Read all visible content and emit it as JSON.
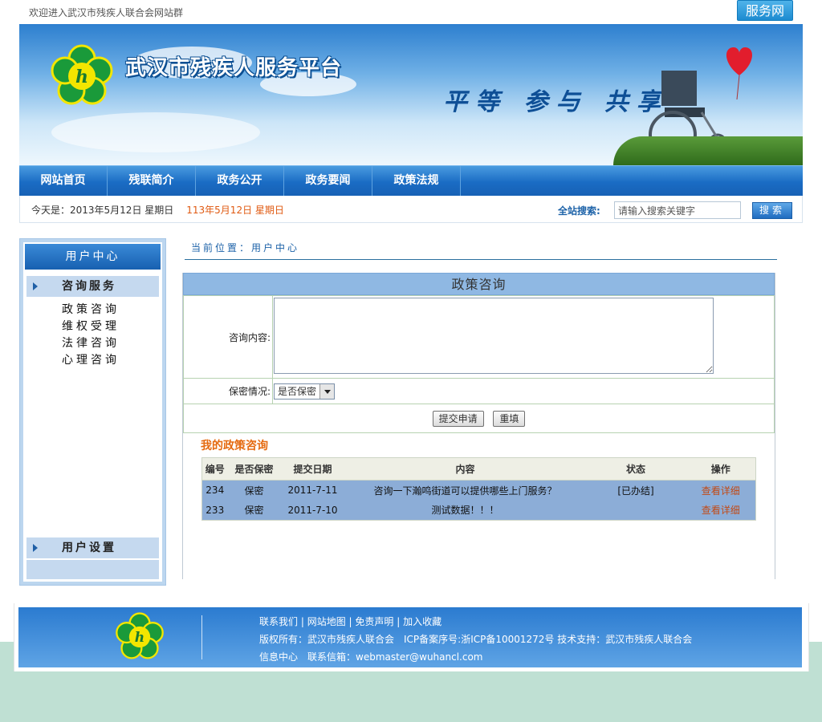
{
  "topbar": {
    "welcome": "欢迎进入武汉市残疾人联合会网站群",
    "badge": "服务网"
  },
  "banner": {
    "title": "武汉市残疾人服务平台",
    "slogan": "平等 参与 共享"
  },
  "nav": [
    "网站首页",
    "残联简介",
    "政务公开",
    "政务要闻",
    "政策法规"
  ],
  "infobar": {
    "today": "今天是：2013年5月12日 星期日",
    "today_alt": "113年5月12日 星期日",
    "search_label": "全站搜索:",
    "search_placeholder": "请输入搜索关键字",
    "search_button": "搜索"
  },
  "sidebar": {
    "header": "用户中心",
    "section1": "咨询服务",
    "items": [
      "政策咨询",
      "维权受理",
      "法律咨询",
      "心理咨询"
    ],
    "section2": "用户设置"
  },
  "breadcrumb": "当前位置：用户中心",
  "form": {
    "title": "政策咨询",
    "content_label": "咨询内容:",
    "content_value": "",
    "secret_label": "保密情况:",
    "secret_selected": "是否保密",
    "submit": "提交申请",
    "reset": "重填"
  },
  "my_list": {
    "title": "我的政策咨询",
    "headers": [
      "编号",
      "是否保密",
      "提交日期",
      "内容",
      "状态",
      "操作"
    ],
    "rows": [
      {
        "id": "234",
        "secret": "保密",
        "date": "2011-7-11",
        "content": "咨询一下瀚鸣街道可以提供哪些上门服务？",
        "status": "[已办结]",
        "action": "查看详细"
      },
      {
        "id": "233",
        "secret": "保密",
        "date": "2011-7-10",
        "content": "测试数据！！！",
        "status": "",
        "action": "查看详细"
      }
    ]
  },
  "footer": {
    "links": [
      "联系我们",
      "网站地图",
      "免责声明",
      "加入收藏"
    ],
    "copyright": "版权所有：武汉市残疾人联合会　ICP备案序号:浙ICP备10001272号 技术支持：武汉市残疾人联合会",
    "contact": "信息中心　联系信箱：webmaster@wuhancl.com"
  },
  "colors": {
    "nav_blue": "#1a6cc4",
    "accent_orange": "#e56a10",
    "row_blue": "#8cadd7"
  }
}
